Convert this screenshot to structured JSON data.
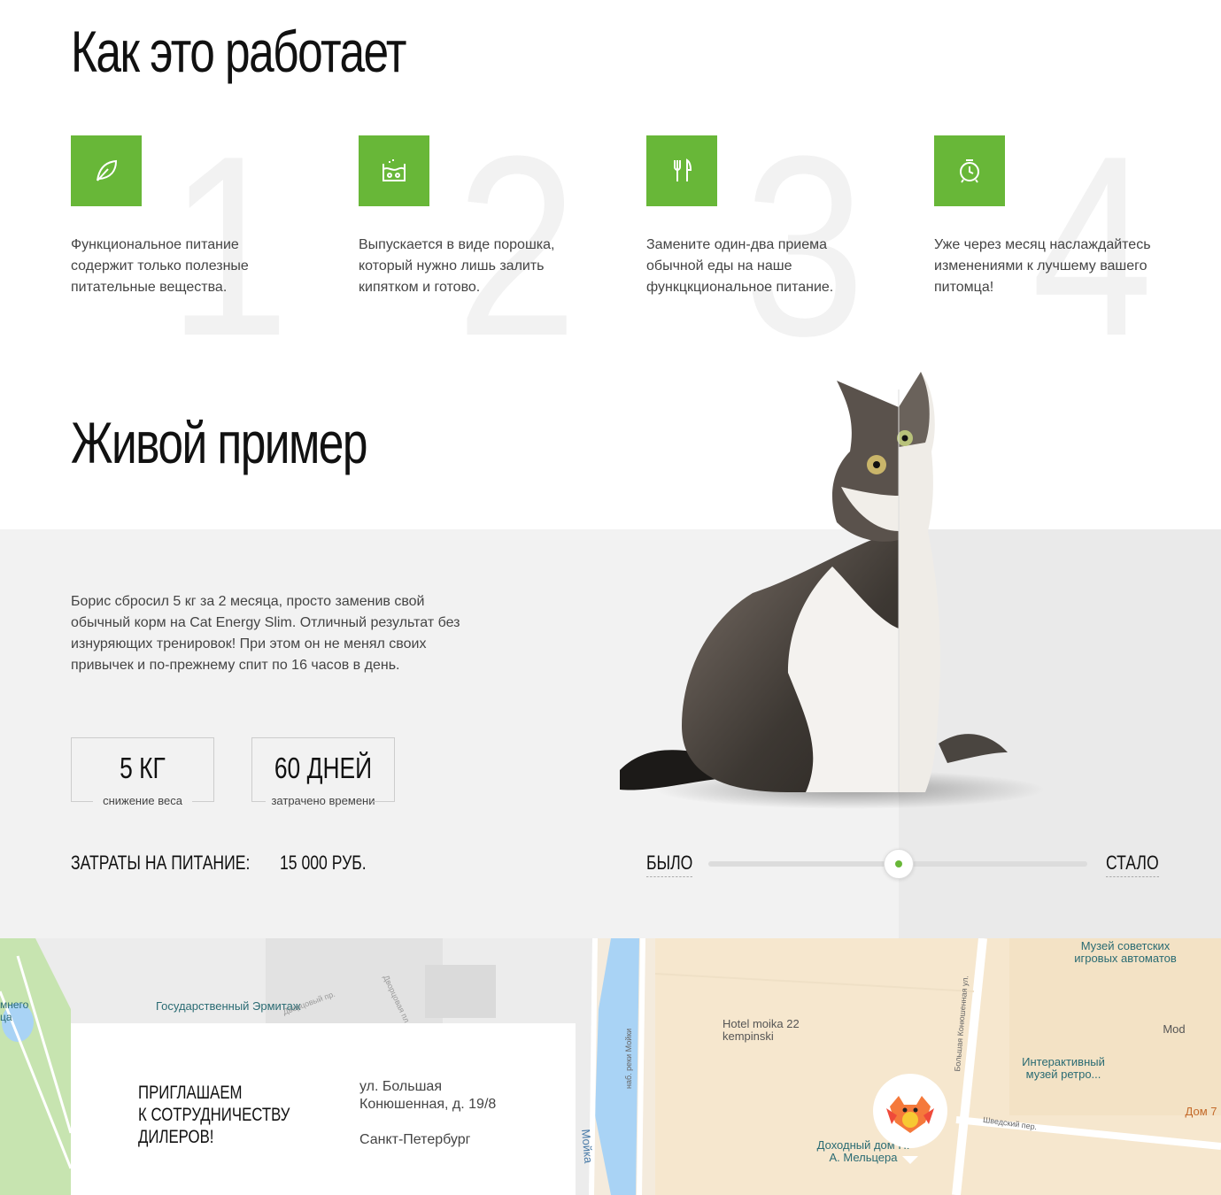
{
  "how": {
    "title": "Как это работает",
    "steps": [
      {
        "num": "1",
        "icon": "leaf-icon",
        "text": "Функциональное питание содержит только полезные питательные вещества."
      },
      {
        "num": "2",
        "icon": "powder-bowl-icon",
        "text": "Выпускается в виде порошка, который нужно лишь залить кипятком и готово."
      },
      {
        "num": "3",
        "icon": "fork-knife-icon",
        "text": "Замените один-два приема обычной еды на наше функцкциональное питание."
      },
      {
        "num": "4",
        "icon": "alarm-clock-icon",
        "text": "Уже через месяц наслаждайтесь изменениями к лучшему вашего питомца!"
      }
    ]
  },
  "live": {
    "title": "Живой пример",
    "story": "Борис сбросил 5 кг за 2 месяца, просто заменив свой обычный корм на Cat Energy Slim. Отличный результат без изнуряющих тренировок! При этом он не менял своих привычек и по-прежнему спит по 16 часов в день.",
    "stats": [
      {
        "value": "5 КГ",
        "label": "снижение веса"
      },
      {
        "value": "60 ДНЕЙ",
        "label": "затрачено времени"
      }
    ],
    "cost_label": "Затраты на питание:",
    "cost_value": "15 000 руб.",
    "slider": {
      "before": "Было",
      "after": "Стало",
      "position": 0.5
    }
  },
  "map": {
    "labels": {
      "hermitage": "Государственный Эрмитаж",
      "dvortsovy": "Дворцовый пр.",
      "dvortsovaya": "Дворцовая пл.",
      "hotel": "Hotel moika 22 kempinski",
      "museum_soviet": "Музей советских игровых автоматов",
      "mod": "Mod",
      "interactive": "Интерактивный музей ретро...",
      "dom7": "Дом 7",
      "dokhodny": "Доходный дом Н. А. Мельцера",
      "shvedsky": "Шведский пер.",
      "moika": "Мойка",
      "konyushennaya": "Большая Конюшенная ул.",
      "naberezhnaya": "наб. реки Мойки",
      "park": "мнего ца"
    }
  },
  "dealer": {
    "title_lines": [
      "Приглашаем",
      "к сотрудничеству",
      "дилеров!"
    ],
    "street": "ул. Большая",
    "house": "Конюшенная, д. 19/8",
    "city": "Санкт-Петербург"
  },
  "colors": {
    "accent": "#68b738",
    "band": "#f2f2f2",
    "band_right": "#eaeaea"
  }
}
